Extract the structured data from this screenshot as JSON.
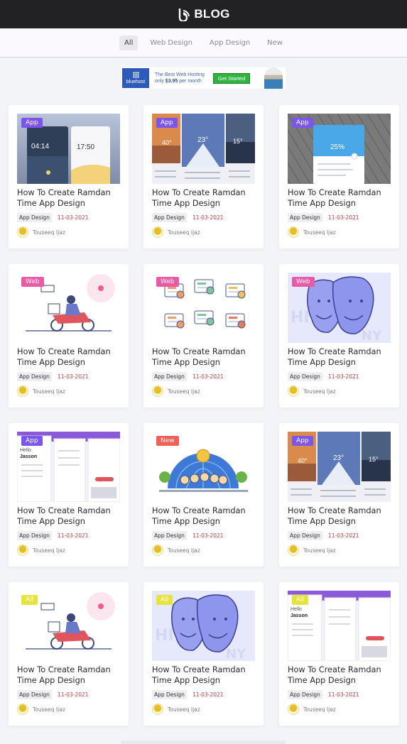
{
  "brand": {
    "name": "BLOG"
  },
  "nav": {
    "tabs": [
      "All",
      "Web Design",
      "App Design",
      "New"
    ],
    "active": "All"
  },
  "ad": {
    "logo_text": "bluehost",
    "line1": "The Best Web Hosting",
    "line2_prefix": "only ",
    "price": "$3.95",
    "line2_suffix": " per month",
    "cta": "Get Started"
  },
  "posts": [
    {
      "badge": "App",
      "badge_type": "app",
      "art": "phones",
      "title": "How To Create Ramdan Time App Design",
      "category": "App Design",
      "date": "11-03-2021",
      "author": "Touseeq Ijaz"
    },
    {
      "badge": "App",
      "badge_type": "app",
      "art": "weather",
      "title": "How To Create Ramdan Time App Design",
      "category": "App Design",
      "date": "11-03-2021",
      "author": "Touseeq Ijaz"
    },
    {
      "badge": "App",
      "badge_type": "app",
      "art": "wood",
      "title": "How To Create Ramdan Time App Design",
      "category": "App Design",
      "date": "11-03-2021",
      "author": "Touseeq Ijaz"
    },
    {
      "badge": "Web",
      "badge_type": "web",
      "art": "bike",
      "title": "How To Create Ramdan Time App Design",
      "category": "App Design",
      "date": "11-03-2021",
      "author": "Touseeq Ijaz"
    },
    {
      "badge": "Web",
      "badge_type": "web",
      "art": "icons",
      "title": "How To Create Ramdan Time App Design",
      "category": "App Design",
      "date": "11-03-2021",
      "author": "Touseeq Ijaz"
    },
    {
      "badge": "Web",
      "badge_type": "web",
      "art": "faces",
      "title": "How To Create Ramdan Time App Design",
      "category": "App Design",
      "date": "11-03-2021",
      "author": "Touseeq Ijaz"
    },
    {
      "badge": "App",
      "badge_type": "app",
      "art": "ui",
      "title": "How To Create Ramdan Time App Design",
      "category": "App Design",
      "date": "11-03-2021",
      "author": "Touseeq Ijaz"
    },
    {
      "badge": "New",
      "badge_type": "new",
      "art": "globe",
      "title": "How To Create Ramdan Time App Design",
      "category": "App Design",
      "date": "11-03-2021",
      "author": "Touseeq Ijaz"
    },
    {
      "badge": "App",
      "badge_type": "app",
      "art": "weather",
      "title": "How To Create Ramdan Time App Design",
      "category": "App Design",
      "date": "11-03-2021",
      "author": "Touseeq Ijaz"
    },
    {
      "badge": "All",
      "badge_type": "all",
      "art": "bike",
      "title": "How To Create Ramdan Time App Design",
      "category": "App Design",
      "date": "11-03-2021",
      "author": "Touseeq Ijaz"
    },
    {
      "badge": "All",
      "badge_type": "all",
      "art": "faces",
      "title": "How To Create Ramdan Time App Design",
      "category": "App Design",
      "date": "11-03-2021",
      "author": "Touseeq Ijaz"
    },
    {
      "badge": "All",
      "badge_type": "all",
      "art": "ui",
      "title": "How To Create Ramdan Time App Design",
      "category": "App Design",
      "date": "11-03-2021",
      "author": "Touseeq Ijaz"
    }
  ],
  "thumb_text": {
    "phones_time_left": "04:14",
    "phones_time_right": "17:50",
    "weather_temps": [
      "40°",
      "23°",
      "15°"
    ],
    "wood_temp": "25%",
    "ui_hello": "Hello",
    "ui_name": "Jasson"
  }
}
